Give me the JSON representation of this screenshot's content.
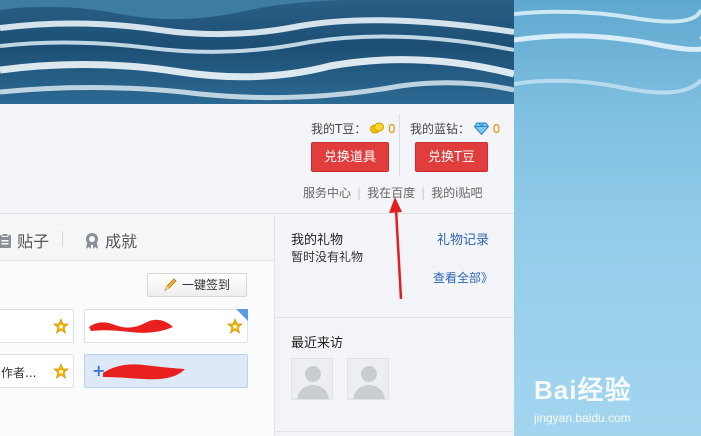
{
  "account": {
    "tbean_label": "我的T豆：",
    "tbean_count": "0",
    "diamond_label": "我的蓝钻：",
    "diamond_count": "0",
    "exchange_props": "兑换道具",
    "exchange_tbean": "兑换T豆"
  },
  "links": [
    "服务中心",
    "我在百度",
    "我的i贴吧"
  ],
  "tabs": {
    "posts": "贴子",
    "achievements": "成就"
  },
  "checkin": {
    "sign_all": "一键签到"
  },
  "forums": [
    {
      "label": ""
    },
    {
      "label": ""
    },
    {
      "label": "作者..."
    },
    {
      "label": ""
    }
  ],
  "gifts": {
    "title": "我的礼物",
    "empty": "暂时没有礼物",
    "record_link": "礼物记录",
    "view_all": "查看全部》"
  },
  "visitors": {
    "title": "最近来访"
  },
  "watermark": {
    "brand": "Bai经验",
    "url": "jingyan.baidu.com"
  },
  "colors": {
    "button_red": "#e23d3d",
    "link_blue": "#2d64b3",
    "count_orange": "#f08a00",
    "annotation_red": "#e02020"
  }
}
